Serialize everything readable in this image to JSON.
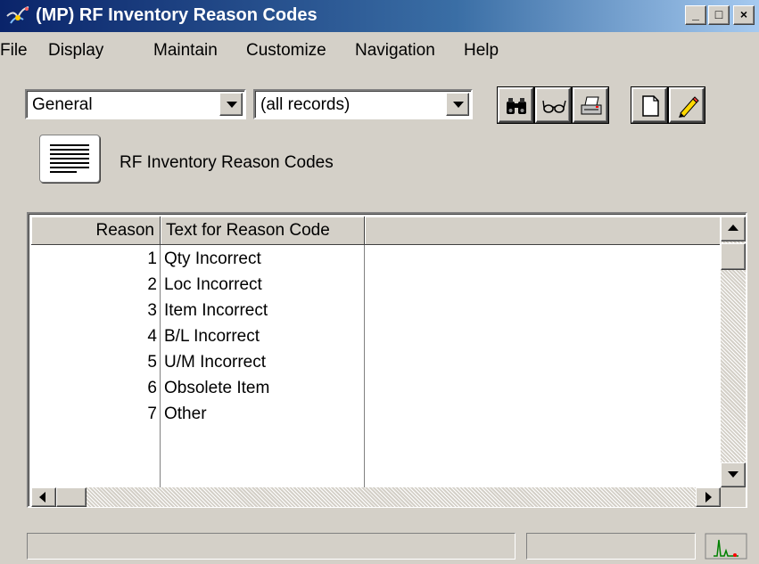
{
  "window": {
    "title": "(MP) RF Inventory Reason Codes"
  },
  "menu": [
    "File",
    "Display",
    "Maintain",
    "Customize",
    "Navigation",
    "Help"
  ],
  "toolbar": {
    "view_select": "General",
    "filter_select": "(all records)",
    "tools": [
      "binoculars-icon",
      "glasses-icon",
      "printer-icon",
      "new-document-icon",
      "pencil-icon"
    ]
  },
  "header": {
    "title": "RF Inventory Reason Codes"
  },
  "grid": {
    "columns": [
      "Reason",
      "Text for Reason Code"
    ],
    "rows": [
      {
        "reason": "1",
        "text": "Qty Incorrect"
      },
      {
        "reason": "2",
        "text": "Loc Incorrect"
      },
      {
        "reason": "3",
        "text": "Item Incorrect"
      },
      {
        "reason": "4",
        "text": "B/L Incorrect"
      },
      {
        "reason": "5",
        "text": "U/M Incorrect"
      },
      {
        "reason": "6",
        "text": "Obsolete Item"
      },
      {
        "reason": "7",
        "text": "Other"
      }
    ]
  },
  "colors": {
    "titlebar_start": "#0a246a",
    "titlebar_end": "#a6caf0",
    "face": "#d4d0c8"
  }
}
